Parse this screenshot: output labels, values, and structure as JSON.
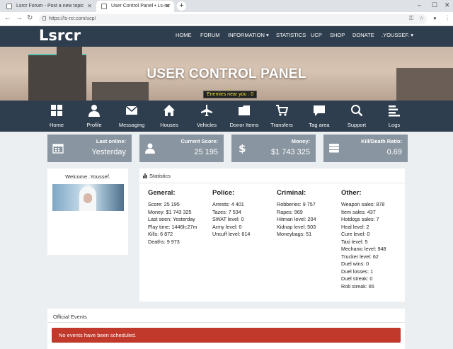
{
  "browser": {
    "tabs": [
      {
        "title": "Lsrcr Forum - Post a new topic"
      },
      {
        "title": "User Control Panel • Ls-rcr"
      }
    ],
    "url": "https://ls-rcr.com/ucp/"
  },
  "site": {
    "logo": "Lsrcr",
    "menu": [
      "HOME",
      "FORUM",
      "INFORMATION ▾",
      "STATISTICS",
      "UCP",
      "SHOP",
      "DONATE",
      ".YOUSSEF. ▾"
    ]
  },
  "banner": {
    "title": "USER CONTROL PANEL",
    "enemies": "Enemies near you : 0"
  },
  "iconbar": {
    "items": [
      "Home",
      "Profile",
      "Messaging",
      "Houses",
      "Vehicles",
      "Donor Items",
      "Transfers",
      "Tag area",
      "Support",
      "Logs"
    ]
  },
  "cards": [
    {
      "label": "Last online:",
      "value": "Yesterday",
      "icon": "calendar-icon"
    },
    {
      "label": "Current Score:",
      "value": "25 195",
      "icon": "user-icon"
    },
    {
      "label": "Money:",
      "value": "$1 743 325",
      "icon": "dollar-icon"
    },
    {
      "label": "Kill/Death Ratio:",
      "value": "0.69",
      "icon": "database-icon"
    }
  ],
  "welcome": {
    "text": "Welcome .Youssef."
  },
  "stats": {
    "title": "Statistics",
    "general": {
      "heading": "General:",
      "rows": [
        "Score: 25 195",
        "Money: $1 743 325",
        "Last seen: Yesterday",
        "Play time: 1446h:27m",
        "Kills: 6 872",
        "Deaths: 9 973"
      ]
    },
    "police": {
      "heading": "Police:",
      "rows": [
        "Arrests: 4 401",
        "Tazes: 7 534",
        "SWAT level: 0",
        "Army level: 0",
        "Uncuff level: 614"
      ]
    },
    "criminal": {
      "heading": "Criminal:",
      "rows": [
        "Robberies: 9 757",
        "Rapes: 969",
        "Hitman level: 204",
        "Kidnap level: 503",
        "Moneybags: 51"
      ]
    },
    "other": {
      "heading": "Other:",
      "rows": [
        "Weapon sales: 878",
        "Item sales: 437",
        "Hotdogs sales: 7",
        "Heal level: 2",
        "Cure level: 0",
        "Taxi level: 5",
        "Mechanic level: 948",
        "Trucker level: 62",
        "Duel wins: 0",
        "Duel losses: 1",
        "Duel streak: 0",
        "Rob streak: 65"
      ]
    }
  },
  "events": {
    "title": "Official Events",
    "alert": "No events have been scheduled."
  },
  "colors": {
    "nav": "#2e3e4e",
    "card": "#8995a0",
    "alert": "#c0392b",
    "enemies_text": "#f0e040"
  }
}
